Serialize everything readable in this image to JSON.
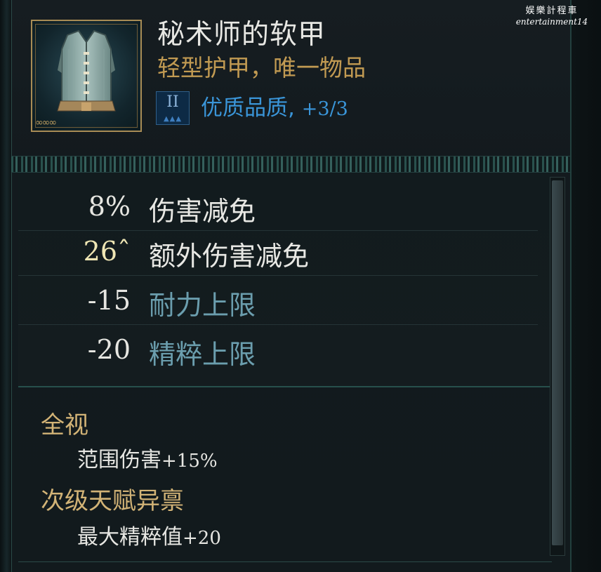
{
  "watermark": {
    "line1": "娱樂計程車",
    "line2": "entertainment14"
  },
  "item": {
    "name": "秘术师的软甲",
    "type_line": "轻型护甲，唯一物品",
    "icon": "cloth-vest-icon",
    "quality": {
      "tier": "II",
      "label": "优质品质,",
      "suffix": "+3/3",
      "color": "#3a95d8"
    }
  },
  "stats": [
    {
      "value": "8%",
      "label": "伤害减免"
    },
    {
      "value": "26ˆ",
      "label": "额外伤害减免"
    },
    {
      "value": "-15",
      "label": "耐力上限"
    },
    {
      "value": "-20",
      "label": "精粹上限"
    }
  ],
  "enchantments": [
    {
      "title": "全视",
      "detail": "范围伤害",
      "detail_value": "+15%"
    },
    {
      "title": "次级天赋异禀",
      "detail": "最大精粹值",
      "detail_value": "+20"
    }
  ],
  "colors": {
    "title": "#e7e7e3",
    "type_line": "#c19a52",
    "section_title": "#d2b376",
    "stat_blue": "#6b9eae"
  }
}
